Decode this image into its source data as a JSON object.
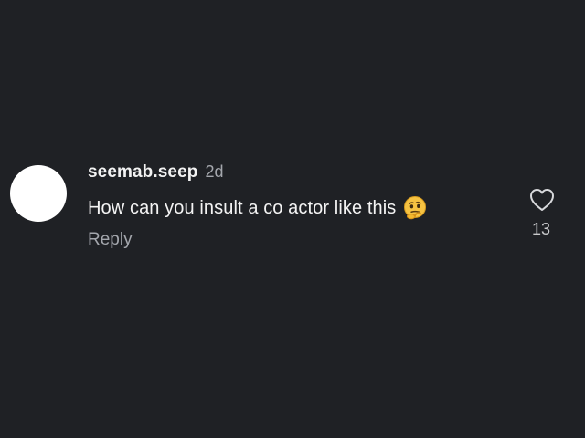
{
  "comment": {
    "username": "seemab.seep",
    "time": "2d",
    "text": "How can you insult a co actor like this",
    "emoji": "thinking-face-icon",
    "reply_label": "Reply",
    "likes": "13"
  },
  "colors": {
    "background": "#1f2125",
    "primary_text": "#f4f4f4",
    "secondary_text": "#a4a7ad",
    "avatar": "#ffffff",
    "emoji_yellow": "#f6c342"
  }
}
